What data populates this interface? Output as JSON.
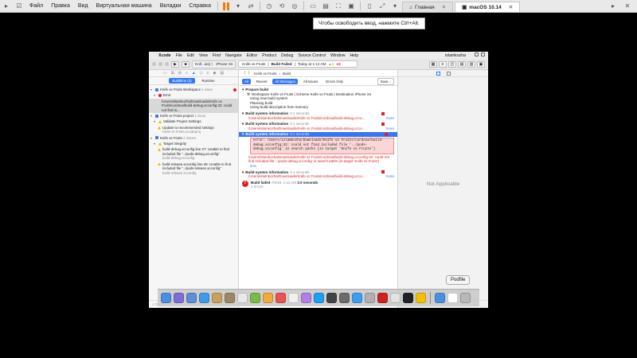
{
  "host": {
    "menu": [
      "Файл",
      "Правка",
      "Вид",
      "Виртуальная машина",
      "Вкладки",
      "Справка"
    ],
    "tabs": [
      {
        "label": "Главная",
        "active": false
      },
      {
        "label": "macOS 10.14",
        "active": true
      }
    ],
    "tooltip": "Чтобы освободить ввод, нажмите Ctrl+Alt."
  },
  "mac_menubar": {
    "apple": "",
    "app": "Xcode",
    "items": [
      "File",
      "Edit",
      "View",
      "Find",
      "Navigate",
      "Editor",
      "Product",
      "Debug",
      "Source Control",
      "Window",
      "Help"
    ],
    "user": "islamkozha"
  },
  "toolbar": {
    "scheme": "Knif...ios)",
    "device": "iPhone Xs",
    "activity_project": "Knife vs Fruits",
    "activity_status": "Build Failed",
    "activity_time": "Today at 1:12 AM",
    "warnings": "4",
    "errors": "2"
  },
  "navigator": {
    "segments": [
      "Buildtime (4)",
      "Runtime"
    ],
    "items": [
      {
        "level": 0,
        "type": "proj",
        "text": "Knife vs Fruits Workspace",
        "sub": "1 issue",
        "badge": "1"
      },
      {
        "level": 1,
        "type": "err",
        "text": "Error",
        "sub": ""
      },
      {
        "level": 2,
        "type": "none",
        "text": "/Users/islamkozha/Downloads/Knife vs Fruits/cordova/build-debug.xcconfig:32: could not find in...",
        "sub": "",
        "selected": true
      },
      {
        "level": 0,
        "type": "proj",
        "text": "Knife vs Fruits project",
        "sub": "1 issue"
      },
      {
        "level": 1,
        "type": "warn",
        "text": "Validate Project Settings",
        "sub": ""
      },
      {
        "level": 2,
        "type": "warn",
        "text": "Update to recommended settings",
        "sub": "Knife vs Fruits.xcodeproj"
      },
      {
        "level": 0,
        "type": "proj",
        "text": "Knife vs Fruits",
        "sub": "2 issues"
      },
      {
        "level": 1,
        "type": "warn",
        "text": "Target Integrity",
        "sub": ""
      },
      {
        "level": 2,
        "type": "warn",
        "text": "build-debug.xcconfig line 27: Unable to find included file \"../pods-debug.xcconfig\"",
        "sub": "build-debug.xcconfig"
      },
      {
        "level": 2,
        "type": "warn",
        "text": "build-release.xcconfig line 28: Unable to find included file \"../pods-release.xcconfig\"",
        "sub": "build-release.xcconfig"
      }
    ],
    "filter_placeholder": "Filter"
  },
  "editor": {
    "breadcrumb": [
      "Knife vs Fruits",
      "Build"
    ],
    "filters": {
      "all": "All",
      "recent": "Recent",
      "all_messages": "All Messages",
      "all_issues": "All Issues",
      "errors_only": "Errors Only",
      "save": "Save..."
    },
    "prepare_title": "Prepare build",
    "prepare_sub": "Workspace Knife vs Fruits | Scheme Knife vs Fruits | Destination iPhone Xs",
    "prepare_lines": [
      "Using new build system",
      "Planning build",
      "Using build description from memory"
    ],
    "sections": [
      {
        "title": "Build system information",
        "time": "0.1 seconds",
        "msg": "/Users/islamkozha/Downloads/Knife vs Fruits/cordova/build-debug.xcco..."
      },
      {
        "title": "Build system information",
        "time": "0.1 seconds",
        "msg": "/Users/islamkozha/Downloads/Knife vs Fruits/cordova/build-debug.xcco..."
      }
    ],
    "selected_section": {
      "title": "Build system information",
      "time": "0.1 seconds",
      "code": "error: /Users/islamkozha/Downloads/Knife vs Fruits/cordova/build-debug.xcconfig:32: could not find included file '../pods-debug.xcconfig' in search paths (in target 'Knife vs Fruits')",
      "msg": "/Users/islamkozha/Downloads/Knife vs Fruits/cordova/build-debug.xcconfig:32: could not find included file '../pods-debug.xcconfig' in search paths (in target 'Knife vs Fruits')",
      "less": "less"
    },
    "last_section": {
      "title": "Build system information",
      "time": "0.1 seconds",
      "msg": "/Users/islamkozha/Downloads/Knife vs Fruits/cordova/build-debug.xcco..."
    },
    "more": "more",
    "result_title": "Build failed",
    "result_date": "7/9/19, 1:12 AM",
    "result_time": "2.0 seconds",
    "result_errors": "4 errors"
  },
  "inspector": {
    "placeholder": "Not Applicable"
  },
  "dock": {
    "tooltip": "Podfile",
    "colors": [
      "#4a90e2",
      "#7a6fd6",
      "#5b8fd9",
      "#3d9be9",
      "#c8a25a",
      "#9b8765",
      "#e9e9e9",
      "#7bb94b",
      "#f2a93b",
      "#ea5353",
      "#f0f0f0",
      "#b47ee6",
      "#1ba1f2",
      "#444",
      "#6c6c6c",
      "#3c9ef0",
      "#b0b0b0",
      "#cc2222",
      "#e2e2e2",
      "#222",
      "#f5c000",
      "#4a90e2",
      "#ffffff",
      "#b8b8b8"
    ]
  }
}
